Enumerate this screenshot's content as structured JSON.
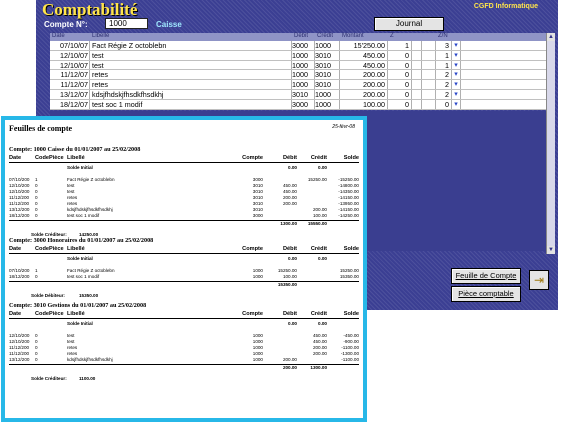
{
  "window": {
    "title": "Comptabilité",
    "brand": "CGFD Informatique",
    "account_label": "Compte N°:",
    "account_value": "1000",
    "account_name": "Caisse",
    "journal_button": "Journal",
    "feuille_button": "Feuille de Compte",
    "piece_button": "Pièce comptable",
    "exit_icon": "exit-door-icon"
  },
  "grid": {
    "headers": [
      "Date",
      "Libellé",
      "Débit",
      "Crédit",
      "Montant",
      "Z",
      "",
      "",
      "Z/N",
      ""
    ],
    "rows": [
      {
        "date": "07/10/07",
        "libelle": "Fact Régie Z octoblebn",
        "c1": "3000",
        "c2": "1000",
        "amount": "15'250.00",
        "z": "1",
        "n": "3"
      },
      {
        "date": "12/10/07",
        "libelle": "test",
        "c1": "1000",
        "c2": "3010",
        "amount": "450.00",
        "z": "0",
        "n": "1"
      },
      {
        "date": "12/10/07",
        "libelle": "test",
        "c1": "1000",
        "c2": "3010",
        "amount": "450.00",
        "z": "0",
        "n": "1"
      },
      {
        "date": "11/12/07",
        "libelle": "retes",
        "c1": "1000",
        "c2": "3010",
        "amount": "200.00",
        "z": "0",
        "n": "2"
      },
      {
        "date": "11/12/07",
        "libelle": "retes",
        "c1": "1000",
        "c2": "3010",
        "amount": "200.00",
        "z": "0",
        "n": "2"
      },
      {
        "date": "13/12/07",
        "libelle": "kdsjfhdskjfhsdkfhsdkhj",
        "c1": "3010",
        "c2": "1000",
        "amount": "200.00",
        "z": "0",
        "n": "2"
      },
      {
        "date": "18/12/07",
        "libelle": "test soc 1 modif",
        "c1": "3000",
        "c2": "1000",
        "amount": "100.00",
        "z": "0",
        "n": "0"
      }
    ]
  },
  "report": {
    "title": "Feuilles de compte",
    "date": "25-févr-08",
    "columns": [
      "Date",
      "Code",
      "Pièce",
      "Libellé",
      "Compte",
      "Débit",
      "Crédit",
      "Solde"
    ],
    "sections": [
      {
        "heading": "Compte: 1000   Caisse du 01/01/2007 au 25/02/2008",
        "initial": {
          "label": "Solde Initial",
          "debit": "0.00",
          "credit": "0.00"
        },
        "lines": [
          {
            "date": "07/10/200",
            "code": "1",
            "piece": "",
            "lib": "Fact Régie Z octoblebn",
            "cpt": "3000",
            "deb": "",
            "cre": "15250.00",
            "sol": "-15250.00"
          },
          {
            "date": "12/10/200",
            "code": "0",
            "piece": "",
            "lib": "test",
            "cpt": "3010",
            "deb": "450.00",
            "cre": "",
            "sol": "-14800.00"
          },
          {
            "date": "12/10/200",
            "code": "0",
            "piece": "",
            "lib": "test",
            "cpt": "3010",
            "deb": "450.00",
            "cre": "",
            "sol": "-14350.00"
          },
          {
            "date": "11/12/200",
            "code": "0",
            "piece": "",
            "lib": "retes",
            "cpt": "3010",
            "deb": "200.00",
            "cre": "",
            "sol": "-14150.00"
          },
          {
            "date": "11/12/200",
            "code": "0",
            "piece": "",
            "lib": "retes",
            "cpt": "3010",
            "deb": "200.00",
            "cre": "",
            "sol": "-13950.00"
          },
          {
            "date": "13/12/200",
            "code": "0",
            "piece": "",
            "lib": "kdsjfhdskjfhsdkfhsdkhj",
            "cpt": "3010",
            "deb": "",
            "cre": "200.00",
            "sol": "-14150.00"
          },
          {
            "date": "18/12/200",
            "code": "0",
            "piece": "",
            "lib": "test soc 1 modif",
            "cpt": "3000",
            "deb": "",
            "cre": "100.00",
            "sol": "-14250.00"
          }
        ],
        "total": {
          "deb": "1300.00",
          "cre": "15550.00"
        },
        "solde": {
          "label": "Solde Créditeur:",
          "value": "14250.00"
        }
      },
      {
        "heading": "Compte: 3000   Honoraires du 01/01/2007 au 25/02/2008",
        "initial": {
          "label": "Solde Initial",
          "debit": "0.00",
          "credit": "0.00"
        },
        "lines": [
          {
            "date": "07/10/200",
            "code": "1",
            "piece": "",
            "lib": "Fact Régie Z octoblebn",
            "cpt": "1000",
            "deb": "15250.00",
            "cre": "",
            "sol": "15250.00"
          },
          {
            "date": "18/12/200",
            "code": "0",
            "piece": "",
            "lib": "test soc 1 modif",
            "cpt": "1000",
            "deb": "100.00",
            "cre": "",
            "sol": "15350.00"
          }
        ],
        "total": {
          "deb": "15350.00",
          "cre": ""
        },
        "solde": {
          "label": "Solde Débiteur:",
          "value": "15350.00"
        }
      },
      {
        "heading": "Compte: 3010   Gestions du 01/01/2007 au 25/02/2008",
        "initial": {
          "label": "Solde Initial",
          "debit": "0.00",
          "credit": "0.00"
        },
        "lines": [
          {
            "date": "12/10/200",
            "code": "0",
            "piece": "",
            "lib": "test",
            "cpt": "1000",
            "deb": "",
            "cre": "450.00",
            "sol": "-450.00"
          },
          {
            "date": "12/10/200",
            "code": "0",
            "piece": "",
            "lib": "test",
            "cpt": "1000",
            "deb": "",
            "cre": "450.00",
            "sol": "-900.00"
          },
          {
            "date": "11/12/200",
            "code": "0",
            "piece": "",
            "lib": "retes",
            "cpt": "1000",
            "deb": "",
            "cre": "200.00",
            "sol": "-1100.00"
          },
          {
            "date": "11/12/200",
            "code": "0",
            "piece": "",
            "lib": "retes",
            "cpt": "1000",
            "deb": "",
            "cre": "200.00",
            "sol": "-1300.00"
          },
          {
            "date": "13/12/200",
            "code": "0",
            "piece": "",
            "lib": "kdsjfhdskjfhsdkfhsdkhj",
            "cpt": "1000",
            "deb": "200.00",
            "cre": "",
            "sol": "-1100.00"
          }
        ],
        "total": {
          "deb": "200.00",
          "cre": "1300.00"
        },
        "solde": {
          "label": "Solde Créditeur:",
          "value": "1100.00"
        }
      }
    ]
  }
}
